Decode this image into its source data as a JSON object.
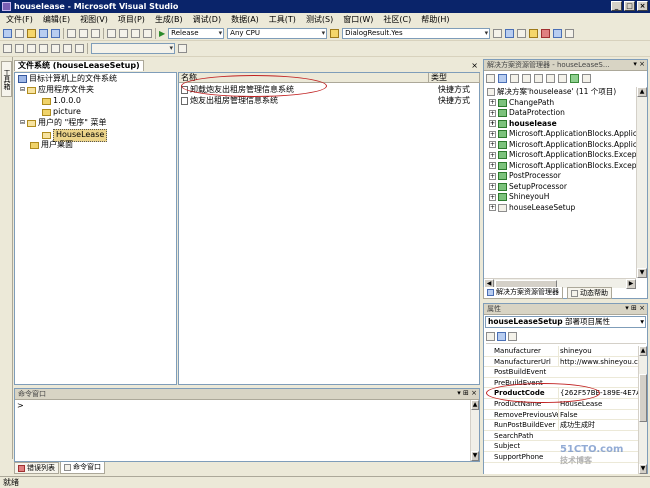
{
  "window": {
    "title": "houselease - Microsoft Visual Studio"
  },
  "menu": [
    "文件(F)",
    "编辑(E)",
    "视图(V)",
    "项目(P)",
    "生成(B)",
    "调试(D)",
    "数据(A)",
    "工具(T)",
    "测试(S)",
    "窗口(W)",
    "社区(C)",
    "帮助(H)"
  ],
  "toolbar": {
    "configuration": "Release",
    "platform": "Any CPU",
    "find_combo": "DialogResult.Yes"
  },
  "left_tab": {
    "label": "工具箱"
  },
  "file_system": {
    "tab_title": "文件系统 (houseLeaseSetup)",
    "tree": {
      "root": "目标计算机上的文件系统",
      "app_folder": "应用程序文件夹",
      "version_folder": "1.0.0.0",
      "picture_folder": "picture",
      "programs_menu": "用户的 \"程序\" 菜单",
      "houselease_folder": "HouseLease",
      "desktop": "用户桌面"
    },
    "columns": {
      "name": "名称",
      "type": "类型"
    },
    "items": [
      {
        "name": "卸载炮友出租房管理信息系统",
        "type": "快捷方式"
      },
      {
        "name": "炮友出租房管理信息系统",
        "type": "快捷方式"
      }
    ]
  },
  "solution_explorer": {
    "title": "解决方案资源管理器 - houseLeaseS...",
    "solution": "解决方案'houselease' (11 个项目)",
    "projects": [
      "ChangePath",
      "DataProtection",
      "houselease",
      "Microsoft.ApplicationBlocks.Applica",
      "Microsoft.ApplicationBlocks.Applica",
      "Microsoft.ApplicationBlocks.Excepti",
      "Microsoft.ApplicationBlocks.Excepti",
      "PostProcessor",
      "SetupProcessor",
      "ShineyouH",
      "houseLeaseSetup"
    ],
    "tabs": [
      "解决方案资源管理器",
      "动态帮助"
    ]
  },
  "properties": {
    "title": "属性",
    "object_name": "houseLeaseSetup",
    "object_type": "部署项目属性",
    "rows": [
      {
        "name": "Manufacturer",
        "value": "shineyou"
      },
      {
        "name": "ManufacturerUrl",
        "value": "http://www.shineyou.cn"
      },
      {
        "name": "PostBuildEvent",
        "value": ""
      },
      {
        "name": "PreBuildEvent",
        "value": ""
      },
      {
        "name": "ProductCode",
        "value": "{262F57BE-189E-4E7A-88"
      },
      {
        "name": "ProductName",
        "value": "HouseLease"
      },
      {
        "name": "RemovePreviousVe",
        "value": "False"
      },
      {
        "name": "RunPostBuildEver",
        "value": "成功生成时"
      },
      {
        "name": "SearchPath",
        "value": ""
      },
      {
        "name": "Subject",
        "value": ""
      },
      {
        "name": "SupportPhone",
        "value": ""
      }
    ]
  },
  "command_window": {
    "title": "命令窗口",
    "prompt": ">"
  },
  "bottom_tabs": [
    "错误列表",
    "命令窗口"
  ],
  "status": {
    "text": "就绪"
  },
  "watermark": {
    "line1": "51CTO.com",
    "line2": "技术博客"
  },
  "colors": {
    "titlebar": "#0a246a",
    "selection": "#0a246a",
    "annotation": "#c02020"
  }
}
